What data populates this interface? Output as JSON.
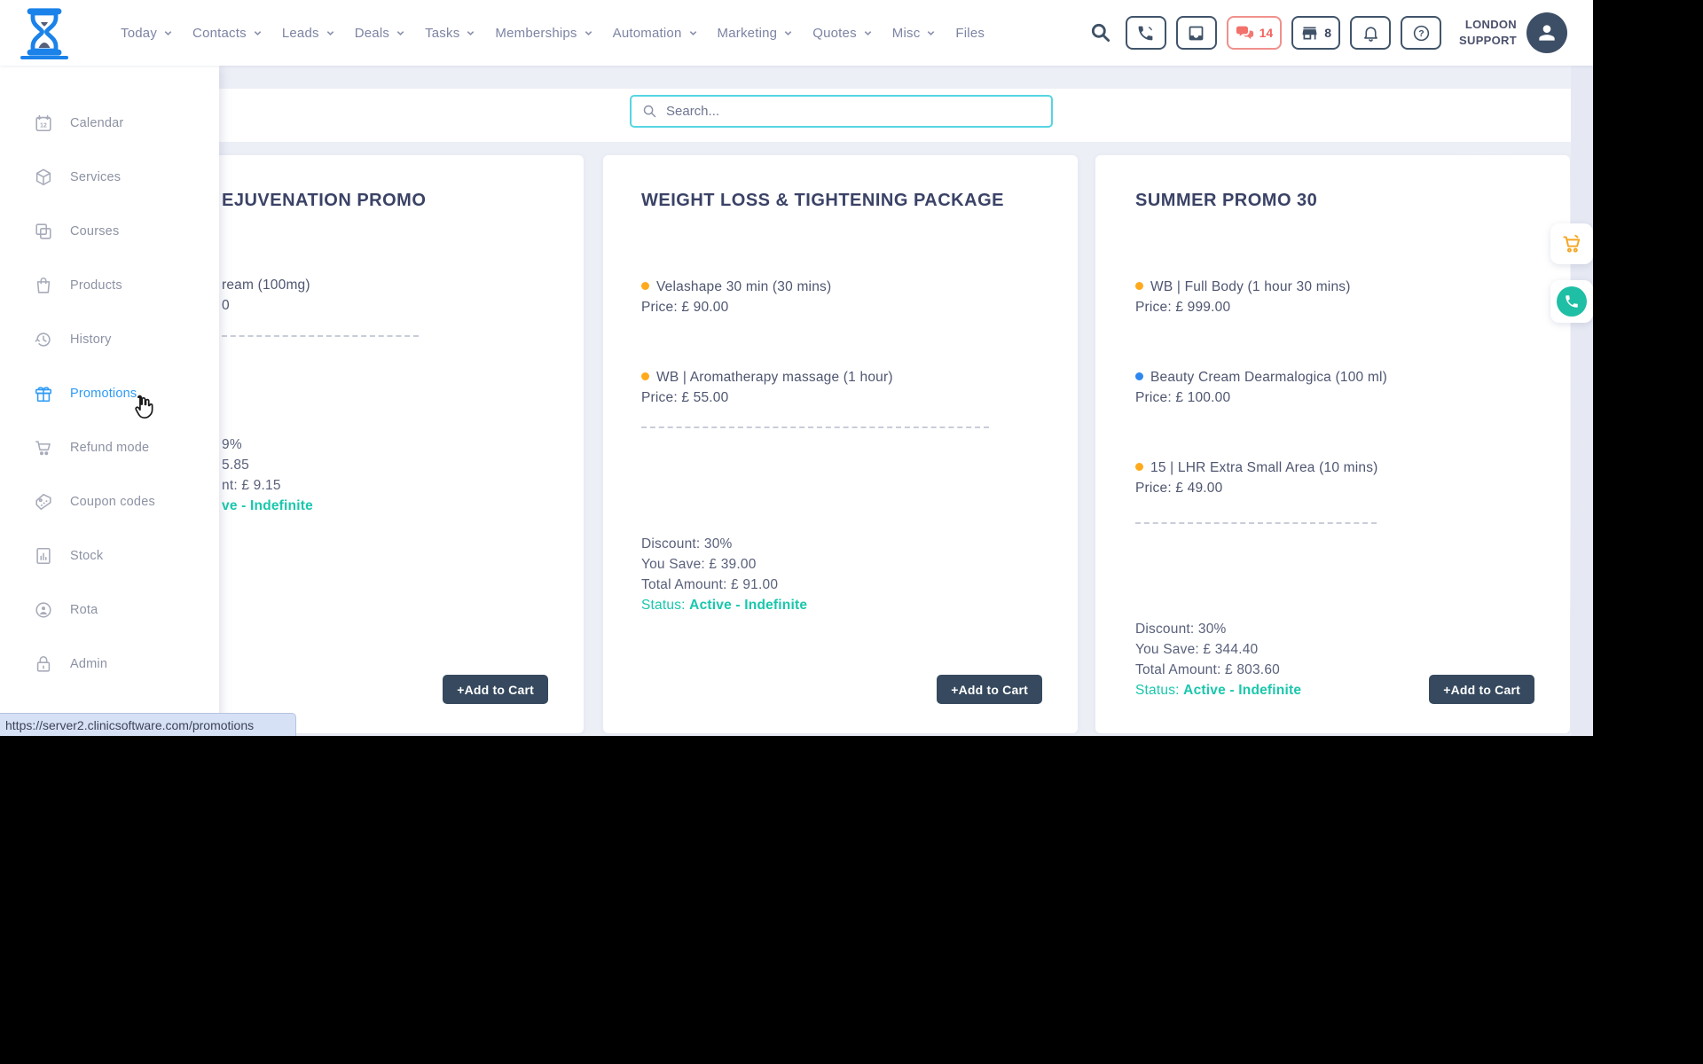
{
  "navbar": {
    "menu": [
      {
        "label": "Today",
        "chevron": true
      },
      {
        "label": "Contacts",
        "chevron": true
      },
      {
        "label": "Leads",
        "chevron": true
      },
      {
        "label": "Deals",
        "chevron": true
      },
      {
        "label": "Tasks",
        "chevron": true
      },
      {
        "label": "Memberships",
        "chevron": true
      },
      {
        "label": "Automation",
        "chevron": true
      },
      {
        "label": "Marketing",
        "chevron": true
      },
      {
        "label": "Quotes",
        "chevron": true
      },
      {
        "label": "Misc",
        "chevron": true
      },
      {
        "label": "Files",
        "chevron": false
      }
    ],
    "chat_count": "14",
    "store_count": "8",
    "account_line1": "LONDON",
    "account_line2": "SUPPORT"
  },
  "toolbar": {
    "search_placeholder": "Search..."
  },
  "sidebar": {
    "items": [
      {
        "label": "Calendar"
      },
      {
        "label": "Services"
      },
      {
        "label": "Courses"
      },
      {
        "label": "Products"
      },
      {
        "label": "History"
      },
      {
        "label": "Promotions",
        "active": true
      },
      {
        "label": "Refund mode"
      },
      {
        "label": "Coupon codes"
      },
      {
        "label": "Stock"
      },
      {
        "label": "Rota"
      },
      {
        "label": "Admin"
      }
    ]
  },
  "cards": [
    {
      "clipped_by_sidebar": true,
      "title": "EJUVENATION PROMO",
      "items": [
        {
          "name": "ream (100mg)",
          "price": "0",
          "bullet": "hidden"
        }
      ],
      "summary": {
        "discount": "9%",
        "you_save": "5.85",
        "total": "nt: £ 9.15",
        "status_value": "ve - Indefinite"
      },
      "button_label": "+Add to Cart"
    },
    {
      "title": "WEIGHT LOSS & TIGHTENING PACKAGE",
      "items": [
        {
          "name": "Velashape 30 min (30 mins)",
          "price": "Price: £ 90.00",
          "bullet": "orange"
        },
        {
          "name": "WB | Aromatherapy massage (1 hour)",
          "price": "Price: £ 55.00",
          "bullet": "orange"
        }
      ],
      "summary": {
        "discount": "Discount: 30%",
        "you_save": "You Save: £ 39.00",
        "total": "Total Amount: £ 91.00",
        "status_label": "Status:",
        "status_value": "Active - Indefinite"
      },
      "button_label": "+Add to Cart"
    },
    {
      "title": "SUMMER PROMO 30",
      "items": [
        {
          "name": "WB | Full Body (1 hour 30 mins)",
          "price": "Price: £ 999.00",
          "bullet": "orange"
        },
        {
          "name": "Beauty Cream Dearmalogica (100 ml)",
          "price": "Price: £ 100.00",
          "bullet": "blue"
        },
        {
          "name": "15 | LHR Extra Small Area (10 mins)",
          "price": "Price: £ 49.00",
          "bullet": "orange"
        }
      ],
      "summary": {
        "discount": "Discount: 30%",
        "you_save": "You Save: £ 344.40",
        "total": "Total Amount: £ 803.60",
        "status_label": "Status:",
        "status_value": "Active - Indefinite"
      },
      "button_label": "+Add to Cart"
    }
  ],
  "statusbar": {
    "url": "https://server2.clinicsoftware.com/promotions"
  },
  "icons": {
    "logo": "hourglass",
    "search": "magnifier",
    "phone": "handset",
    "inbox": "tray",
    "chat": "speech-bubbles",
    "store": "storefront",
    "bell": "notification-bell",
    "help": "question-circle",
    "avatar": "person",
    "floating": [
      "cart",
      "whatsapp-phone"
    ],
    "sidebar": [
      "calendar-12",
      "cube",
      "overlapping-squares",
      "shopping-bag",
      "history-clock",
      "gift",
      "cart",
      "coupon-tag",
      "stock-doc",
      "person-circle",
      "lock"
    ]
  },
  "colors": {
    "accent_blue": "#2e9bf5",
    "logo_blue": "#1b82ea",
    "teal_status": "#19c7ac",
    "orange_bullet": "#ffaa1d",
    "blue_bullet": "#2e86f0",
    "salmon_alert": "#f2635c",
    "dark_slate_button": "#36495e",
    "search_border_cyan": "#56d5e2",
    "page_bg": "#edeff7"
  }
}
